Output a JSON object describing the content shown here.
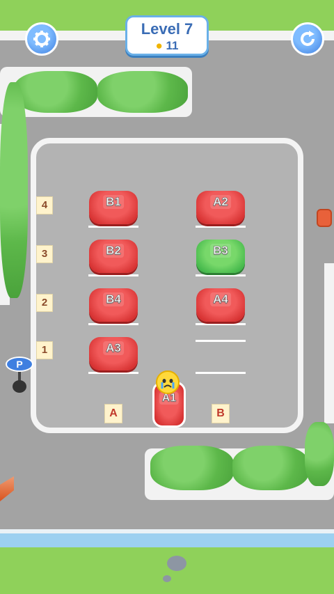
{
  "header": {
    "level": "Level 7",
    "coin_icon": "coin-icon",
    "coins": "11",
    "settings_icon": "gear-icon",
    "restart_icon": "restart-icon"
  },
  "rows": [
    "4",
    "3",
    "2",
    "1"
  ],
  "columns": [
    "A",
    "B"
  ],
  "cars": [
    {
      "label": "B1",
      "color": "red"
    },
    {
      "label": "A2",
      "color": "red"
    },
    {
      "label": "B2",
      "color": "red"
    },
    {
      "label": "B3",
      "color": "green"
    },
    {
      "label": "B4",
      "color": "red"
    },
    {
      "label": "A4",
      "color": "red"
    },
    {
      "label": "A3",
      "color": "red"
    },
    {
      "label": "A1",
      "color": "red"
    }
  ],
  "parking_sign": "P",
  "colors": {
    "accent_blue": "#3f7fe0",
    "car_red": "#d42e2e",
    "car_green": "#3fb548",
    "grass": "#8fd15a",
    "asphalt": "#a3a3a3"
  }
}
